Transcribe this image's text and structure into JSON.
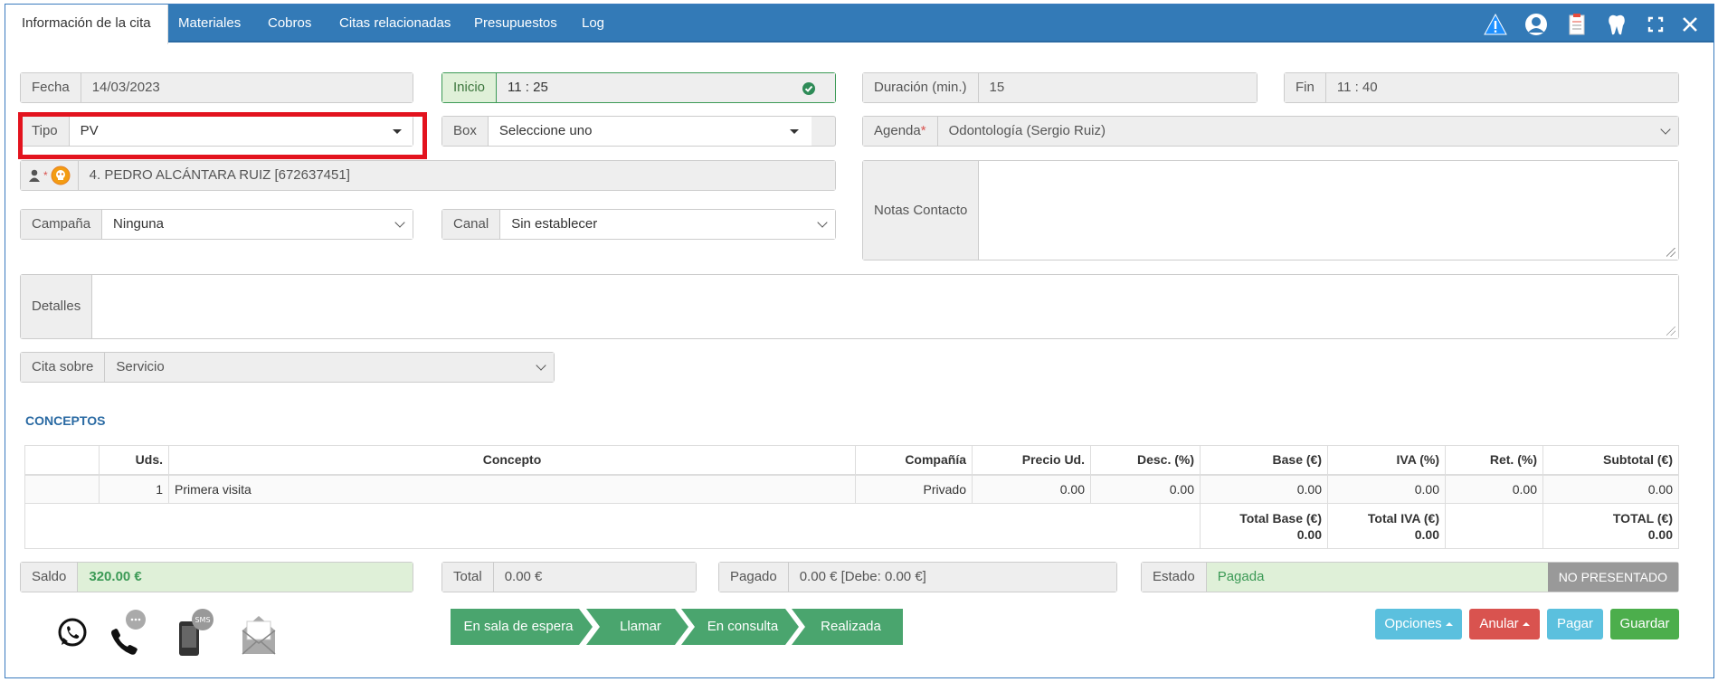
{
  "tabs": [
    {
      "label": "Información de la cita",
      "active": true
    },
    {
      "label": "Materiales"
    },
    {
      "label": "Cobros"
    },
    {
      "label": "Citas relacionadas"
    },
    {
      "label": "Presupuestos"
    },
    {
      "label": "Log"
    }
  ],
  "toolbar_icons": [
    "warning-icon",
    "user-icon",
    "clipboard-icon",
    "tooth-icon",
    "expand-icon",
    "close-icon"
  ],
  "form": {
    "fecha": {
      "label": "Fecha",
      "value": "14/03/2023"
    },
    "inicio": {
      "label": "Inicio",
      "value": "11 : 25"
    },
    "duracion": {
      "label": "Duración (min.)",
      "value": "15"
    },
    "fin": {
      "label": "Fin",
      "value": "11 : 40"
    },
    "tipo": {
      "label": "Tipo",
      "value": "PV"
    },
    "box": {
      "label": "Box",
      "value": "Seleccione uno"
    },
    "agenda": {
      "label": "Agenda",
      "required": "*",
      "value": "Odontología (Sergio Ruiz)"
    },
    "paciente": {
      "required": "*",
      "value": "4. PEDRO ALCÁNTARA RUIZ [672637451]"
    },
    "notas_contacto": {
      "label": "Notas Contacto",
      "value": ""
    },
    "campana": {
      "label": "Campaña",
      "value": "Ninguna"
    },
    "canal": {
      "label": "Canal",
      "value": "Sin establecer"
    },
    "detalles": {
      "label": "Detalles",
      "value": ""
    },
    "cita_sobre": {
      "label": "Cita sobre",
      "value": "Servicio"
    }
  },
  "conceptos": {
    "title": "CONCEPTOS",
    "headers": [
      "",
      "Uds.",
      "Concepto",
      "Compañía",
      "Precio Ud.",
      "Desc. (%)",
      "Base (€)",
      "IVA (%)",
      "Ret. (%)",
      "Subtotal (€)"
    ],
    "rows": [
      [
        "",
        "1",
        "Primera visita",
        "Privado",
        "0.00",
        "0.00",
        "0.00",
        "0.00",
        "0.00",
        "0.00"
      ]
    ],
    "totals": {
      "base_label": "Total Base (€)",
      "base": "0.00",
      "iva_label": "Total IVA (€)",
      "iva": "0.00",
      "total_label": "TOTAL (€)",
      "total": "0.00"
    }
  },
  "summary": {
    "saldo": {
      "label": "Saldo",
      "value": "320.00 €"
    },
    "total": {
      "label": "Total",
      "value": "0.00 €"
    },
    "pagado": {
      "label": "Pagado",
      "value": "0.00 € [Debe: 0.00 €]"
    },
    "estado": {
      "label": "Estado",
      "value": "Pagada",
      "badge": "NO PRESENTADO"
    }
  },
  "contact_icons": [
    "whatsapp-icon",
    "phone-icon",
    "sms-icon",
    "email-icon"
  ],
  "sms_icon_text": "SMS",
  "steps": [
    "En sala de espera",
    "Llamar",
    "En consulta",
    "Realizada"
  ],
  "actions": {
    "opciones": "Opciones",
    "anular": "Anular",
    "pagar": "Pagar",
    "guardar": "Guardar"
  },
  "colors": {
    "header": "#337ab7",
    "success": "#4aa56e",
    "info": "#5bc0de",
    "danger": "#d9534f",
    "highlight": "#e3131e"
  }
}
